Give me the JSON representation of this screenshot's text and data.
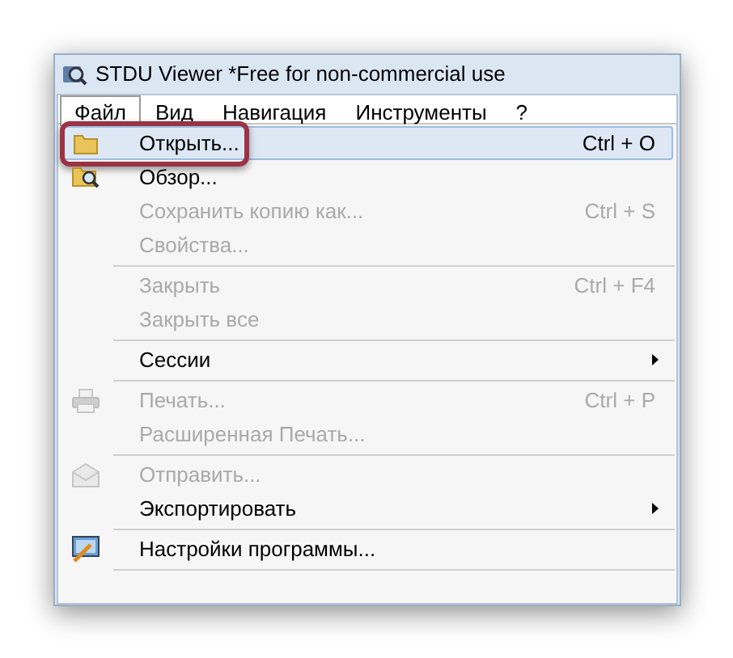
{
  "window": {
    "title": "STDU Viewer *Free for non-commercial use"
  },
  "menubar": [
    {
      "label": "Файл",
      "selected": true
    },
    {
      "label": "Вид",
      "selected": false
    },
    {
      "label": "Навигация",
      "selected": false
    },
    {
      "label": "Инструменты",
      "selected": false
    },
    {
      "label": "?",
      "selected": false
    }
  ],
  "menu": [
    {
      "kind": "open",
      "label": "Открыть...",
      "shortcut": "Ctrl + O",
      "disabled": false,
      "selected": true,
      "circled": true
    },
    {
      "kind": "browse",
      "label": "Обзор...",
      "disabled": false,
      "selected": false
    },
    {
      "kind": "plain",
      "label": "Сохранить копию как...",
      "shortcut": "Ctrl + S",
      "disabled": true,
      "selected": false
    },
    {
      "kind": "plain",
      "label": "Свойства...",
      "disabled": true,
      "selected": false
    },
    {
      "kind": "separator"
    },
    {
      "kind": "plain",
      "label": "Закрыть",
      "shortcut": "Ctrl + F4",
      "disabled": true,
      "selected": false
    },
    {
      "kind": "plain",
      "label": "Закрыть все",
      "disabled": true,
      "selected": false
    },
    {
      "kind": "separator"
    },
    {
      "kind": "plain",
      "label": "Сессии",
      "disabled": false,
      "selected": false,
      "submenu": true
    },
    {
      "kind": "separator"
    },
    {
      "kind": "print",
      "label": "Печать...",
      "shortcut": "Ctrl + P",
      "disabled": true,
      "selected": false
    },
    {
      "kind": "plain",
      "label": "Расширенная Печать...",
      "disabled": true,
      "selected": false
    },
    {
      "kind": "separator"
    },
    {
      "kind": "send",
      "label": "Отправить...",
      "disabled": true,
      "selected": false
    },
    {
      "kind": "plain",
      "label": "Экспортировать",
      "disabled": false,
      "selected": false,
      "submenu": true
    },
    {
      "kind": "separator"
    },
    {
      "kind": "settings",
      "label": "Настройки программы...",
      "disabled": false,
      "selected": false
    },
    {
      "kind": "separator"
    }
  ]
}
